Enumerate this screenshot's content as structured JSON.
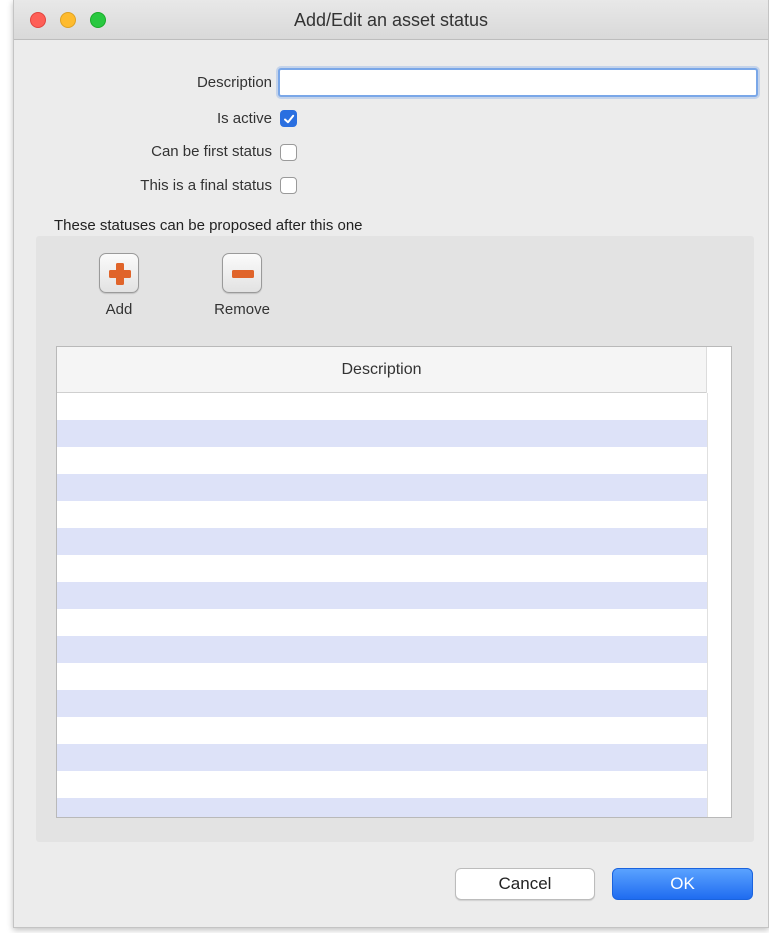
{
  "window": {
    "title": "Add/Edit an asset status"
  },
  "form": {
    "description_label": "Description",
    "description_value": "",
    "is_active_label": "Is active",
    "is_active_checked": true,
    "can_be_first_label": "Can be first status",
    "can_be_first_checked": false,
    "final_status_label": "This is a final status",
    "final_status_checked": false
  },
  "proposed": {
    "section_label": "These statuses can be proposed after this one",
    "add_label": "Add",
    "remove_label": "Remove",
    "table": {
      "columns": [
        "Description"
      ],
      "rows": []
    }
  },
  "buttons": {
    "cancel": "Cancel",
    "ok": "OK"
  },
  "colors": {
    "accent": "#2a6fe0",
    "row_stripe": "#dde2f8",
    "add_icon": "#e0642a",
    "remove_icon": "#e0642a"
  },
  "icons": {
    "add": "plus-icon",
    "remove": "minus-icon"
  }
}
